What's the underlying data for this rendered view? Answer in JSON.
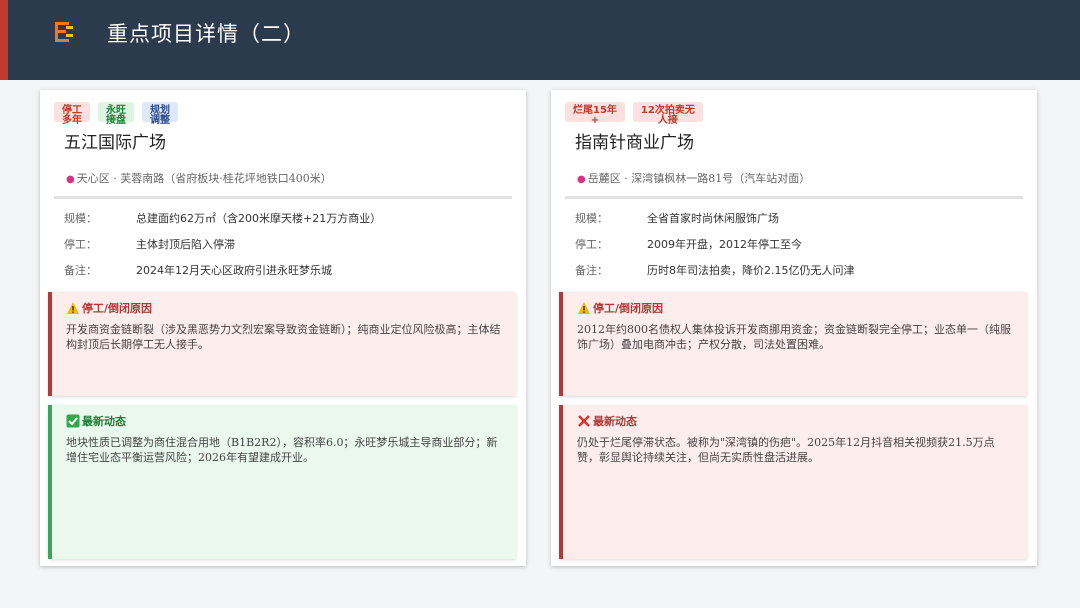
{
  "header": {
    "title": "重点项目详情（二）"
  },
  "colors": {
    "header_bg": "#2b3a4d",
    "accent": "#c0392b",
    "tag_red": "#fde0e0",
    "tag_green": "#dff5e3",
    "tag_blue": "#dfe8f8"
  },
  "cards": [
    {
      "tags": [
        {
          "label": "停工\n多年",
          "color": "red"
        },
        {
          "label": "永旺\n接盘",
          "color": "green"
        },
        {
          "label": "规划\n调整",
          "color": "blue"
        }
      ],
      "name": "五江国际广场",
      "location": "天心区 · 芙蓉南路（省府板块·桂花坪地铁口400米）",
      "info": [
        {
          "label": "规模：",
          "value": "总建面约62万㎡（含200米摩天楼+21万方商业）"
        },
        {
          "label": "停工：",
          "value": "主体封顶后陷入停滞"
        },
        {
          "label": "备注：",
          "value": "2024年12月天心区政府引进永旺梦乐城"
        }
      ],
      "reason": {
        "title": "停工/倒闭原因",
        "text": "开发商资金链断裂（涉及黑恶势力文烈宏案导致资金链断）；纯商业定位风险极高；主体结构封顶后长期停工无人接手。"
      },
      "news": {
        "title": "最新动态",
        "text": "地块性质已调整为商住混合用地（B1B2R2），容积率6.0；永旺梦乐城主导商业部分；新增住宅业态平衡运营风险；2026年有望建成开业。"
      }
    },
    {
      "tags": [
        {
          "label": "烂尾15年\n+",
          "color": "red"
        },
        {
          "label": "12次拍卖无\n人接",
          "color": "red"
        }
      ],
      "name": "指南针商业广场",
      "location": "岳麓区 · 深湾镇枫林一路81号（汽车站对面）",
      "info": [
        {
          "label": "规模：",
          "value": "全省首家时尚休闲服饰广场"
        },
        {
          "label": "停工：",
          "value": "2009年开盘，2012年停工至今"
        },
        {
          "label": "备注：",
          "value": "历时8年司法拍卖，降价2.15亿仍无人问津"
        }
      ],
      "reason": {
        "title": "停工/倒闭原因",
        "text": "2012年约800名债权人集体投诉开发商挪用资金；资金链断裂完全停工；业态单一（纯服饰广场）叠加电商冲击；产权分散，司法处置困难。"
      },
      "news": {
        "title": "最新动态",
        "text": "仍处于烂尾停滞状态。被称为\"深湾镇的伤疤\"。2025年12月抖音相关视频获21.5万点赞，彰显舆论持续关注，但尚无实质性盘活进展。"
      }
    }
  ]
}
